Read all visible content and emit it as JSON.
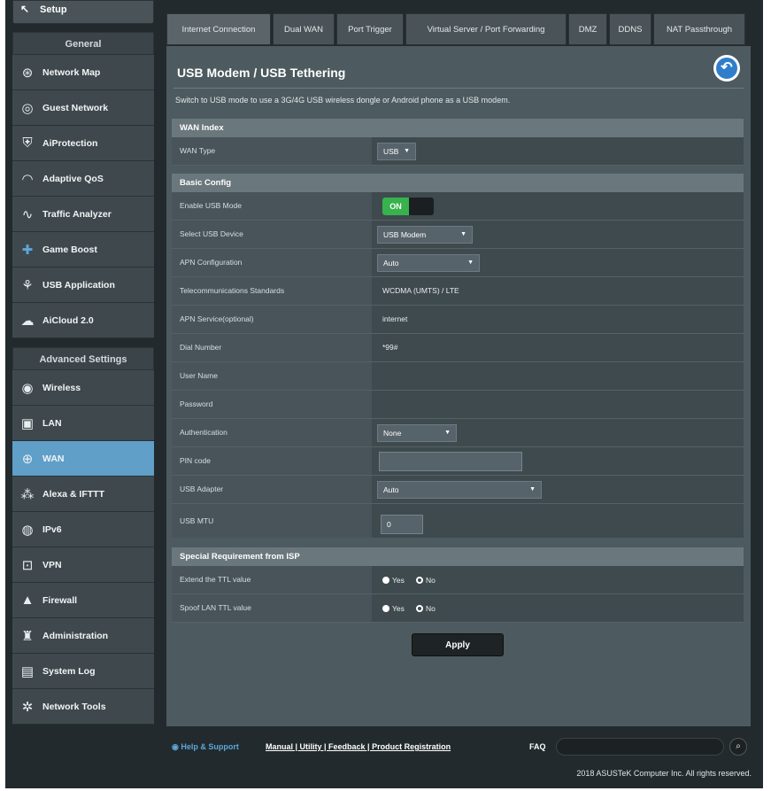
{
  "sidebar": {
    "setup_label": "Setup",
    "general_header": "General",
    "general_items": [
      {
        "label": "Network Map",
        "icon": "network-map-icon"
      },
      {
        "label": "Guest Network",
        "icon": "guest-network-icon"
      },
      {
        "label": "AiProtection",
        "icon": "shield-icon"
      },
      {
        "label": "Adaptive QoS",
        "icon": "gauge-icon"
      },
      {
        "label": "Traffic Analyzer",
        "icon": "pulse-icon"
      },
      {
        "label": "Game Boost",
        "icon": "gamepad-icon"
      },
      {
        "label": "USB Application",
        "icon": "usb-icon"
      },
      {
        "label": "AiCloud 2.0",
        "icon": "cloud-icon"
      }
    ],
    "advanced_header": "Advanced Settings",
    "advanced_items": [
      {
        "label": "Wireless",
        "icon": "wireless-icon"
      },
      {
        "label": "LAN",
        "icon": "lan-icon"
      },
      {
        "label": "WAN",
        "icon": "globe-icon"
      },
      {
        "label": "Alexa & IFTTT",
        "icon": "alexa-icon"
      },
      {
        "label": "IPv6",
        "icon": "ipv6-icon"
      },
      {
        "label": "VPN",
        "icon": "vpn-icon"
      },
      {
        "label": "Firewall",
        "icon": "firewall-icon"
      },
      {
        "label": "Administration",
        "icon": "admin-icon"
      },
      {
        "label": "System Log",
        "icon": "log-icon"
      },
      {
        "label": "Network Tools",
        "icon": "tools-icon"
      }
    ],
    "active_item": "WAN"
  },
  "tabs": [
    {
      "label": "Internet Connection"
    },
    {
      "label": "Dual WAN"
    },
    {
      "label": "Port Trigger"
    },
    {
      "label": "Virtual Server / Port Forwarding"
    },
    {
      "label": "DMZ"
    },
    {
      "label": "DDNS"
    },
    {
      "label": "NAT Passthrough"
    }
  ],
  "page": {
    "title": "USB Modem / USB Tethering",
    "description": "Switch to USB mode to use a 3G/4G USB wireless dongle or Android phone as a USB modem."
  },
  "wan_index": {
    "header": "WAN Index",
    "wan_type_label": "WAN Type",
    "wan_type_value": "USB"
  },
  "basic": {
    "header": "Basic Config",
    "rows": {
      "enable_label": "Enable USB Mode",
      "enable_value": "ON",
      "device_label": "Select USB Device",
      "device_value": "USB Modem",
      "apn_label": "APN Configuration",
      "apn_value": "Auto",
      "telecom_label": "Telecommunications Standards",
      "telecom_value": "WCDMA (UMTS) / LTE",
      "apn_service_label": "APN Service(optional)",
      "apn_service_value": "internet",
      "dial_label": "Dial Number",
      "dial_value": "*99#",
      "user_label": "User Name",
      "user_value": "",
      "password_label": "Password",
      "password_value": "",
      "auth_label": "Authentication",
      "auth_value": "None",
      "pin_label": "PIN code",
      "pin_value": "",
      "adapter_label": "USB Adapter",
      "adapter_value": "Auto",
      "mtu_label": "USB MTU",
      "mtu_value": "0"
    }
  },
  "special": {
    "header": "Special Requirement from ISP",
    "ttl_label": "Extend the TTL value",
    "spoof_label": "Spoof LAN TTL value",
    "yes": "Yes",
    "no": "No"
  },
  "apply_label": "Apply",
  "footer": {
    "help": "Help & Support",
    "links": "Manual | Utility | Feedback | Product Registration",
    "faq": "FAQ",
    "copyright": "2018 ASUSTeK Computer Inc. All rights reserved."
  }
}
